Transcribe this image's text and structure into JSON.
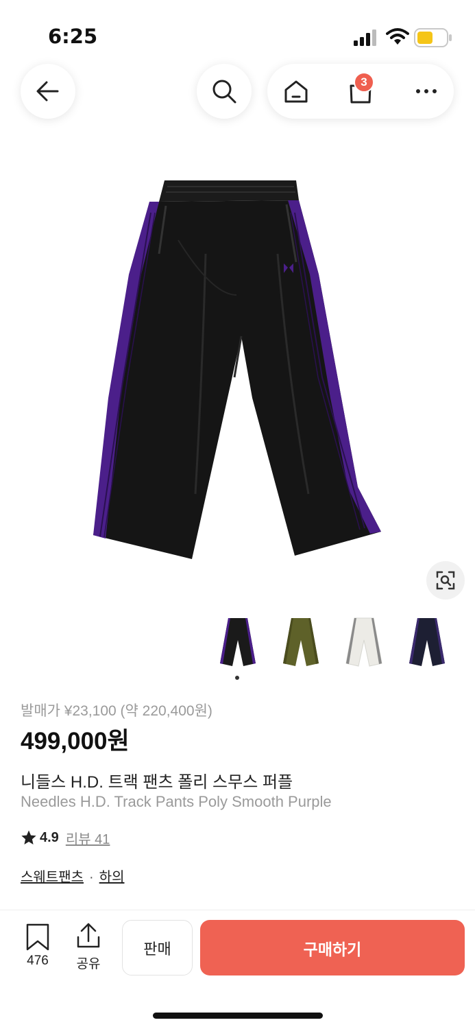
{
  "status_bar": {
    "time": "6:25"
  },
  "nav": {
    "cart_count": "3"
  },
  "product": {
    "release_price": "발매가 ¥23,100 (약 220,400원)",
    "price": "499,000원",
    "name_ko": "니들스 H.D. 트랙 팬츠 폴리 스무스 퍼플",
    "name_en": "Needles H.D. Track Pants Poly Smooth Purple",
    "rating": "4.9",
    "review_label": "리뷰 41",
    "categories": [
      "스웨트팬츠",
      "하의"
    ],
    "category_separator": "·"
  },
  "thumbnails": [
    {
      "name": "black-purple",
      "color": "#1a1a1a",
      "stripe": "#4b1f8a"
    },
    {
      "name": "olive",
      "color": "#5e6129",
      "stripe": "#4a4c1e"
    },
    {
      "name": "white-grey",
      "color": "#ecebe6",
      "stripe": "#8a8a8a"
    },
    {
      "name": "navy",
      "color": "#1d1f33",
      "stripe": "#3b2a6e"
    }
  ],
  "bottom_bar": {
    "bookmark_count": "476",
    "share_label": "공유",
    "sell_label": "판매",
    "buy_label": "구매하기"
  },
  "colors": {
    "accent": "#ef6253",
    "badge": "#ef5f4f",
    "pants": "#151515",
    "stripe": "#4b1f8a"
  }
}
